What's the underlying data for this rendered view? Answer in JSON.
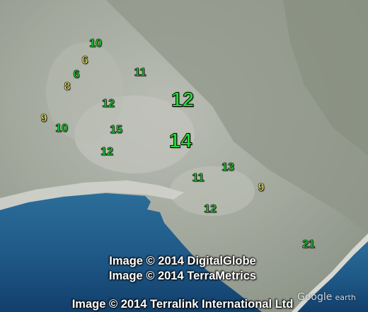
{
  "map": {
    "markers": [
      {
        "label": "10",
        "color": "#22dd33"
      },
      {
        "label": "6",
        "color": "#f4f06a"
      },
      {
        "label": "6",
        "color": "#22dd33"
      },
      {
        "label": "8",
        "color": "#f4f06a"
      },
      {
        "label": "11",
        "color": "#22dd33"
      },
      {
        "label": "12",
        "color": "#22dd33"
      },
      {
        "label": "12",
        "color": "#22dd33"
      },
      {
        "label": "9",
        "color": "#f4f06a"
      },
      {
        "label": "10",
        "color": "#22dd33"
      },
      {
        "label": "15",
        "color": "#22dd33"
      },
      {
        "label": "14",
        "color": "#22dd33"
      },
      {
        "label": "12",
        "color": "#22dd33"
      },
      {
        "label": "11",
        "color": "#22dd33"
      },
      {
        "label": "13",
        "color": "#22dd33"
      },
      {
        "label": "9",
        "color": "#f4f06a"
      },
      {
        "label": "12",
        "color": "#22dd33"
      },
      {
        "label": "21",
        "color": "#22dd33"
      }
    ],
    "credits": [
      "Image © 2014 DigitalGlobe",
      "Image © 2014 TerraMetrics",
      "Image © 2014 Terralink International Ltd"
    ],
    "logo": {
      "google": "Google",
      "earth": "earth"
    }
  }
}
